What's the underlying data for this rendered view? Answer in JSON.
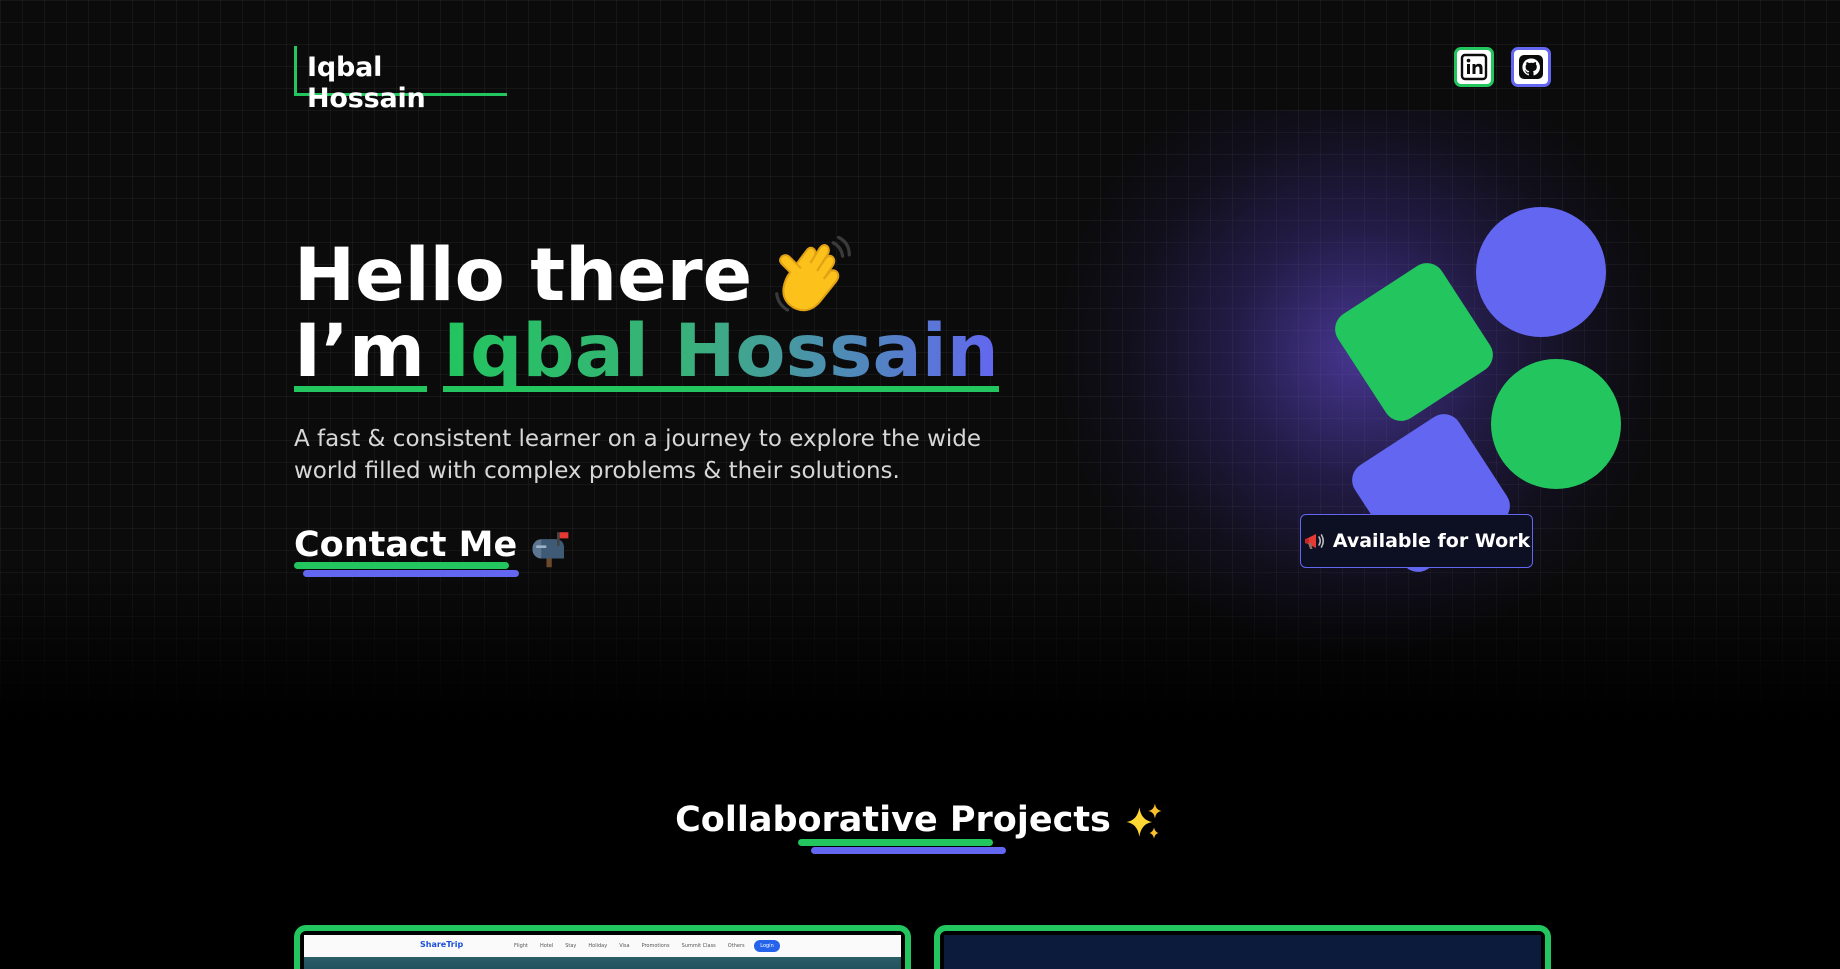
{
  "header": {
    "logo_text": "Iqbal Hossain",
    "social_links": [
      {
        "name": "LinkedIn",
        "icon": "linkedin-icon"
      },
      {
        "name": "GitHub",
        "icon": "github-icon"
      }
    ]
  },
  "hero": {
    "greeting": "Hello there",
    "greeting_icon": "waving-hand-icon",
    "im_prefix": "I’m",
    "name": "Iqbal Hossain",
    "tagline": "A fast & consistent learner on a journey to explore the wide world filled with complex problems & their solutions.",
    "contact_label": "Contact Me",
    "contact_icon": "mailbox-icon",
    "status_badge": "Available for Work",
    "status_icon": "megaphone-icon"
  },
  "projects": {
    "title": "Collaborative Projects",
    "title_icon": "sparkles-icon",
    "cards": [
      {
        "preview": {
          "logo": "ShareTrip",
          "nav_links": [
            "Flight",
            "Hotel",
            "Stay",
            "Holiday",
            "Visa",
            "Promotions",
            "Summit Class",
            "Others"
          ],
          "login": "Login"
        }
      },
      {}
    ]
  },
  "colors": {
    "accent_green": "#22c55e",
    "accent_purple": "#6366f1",
    "background": "#0b0b0c"
  }
}
